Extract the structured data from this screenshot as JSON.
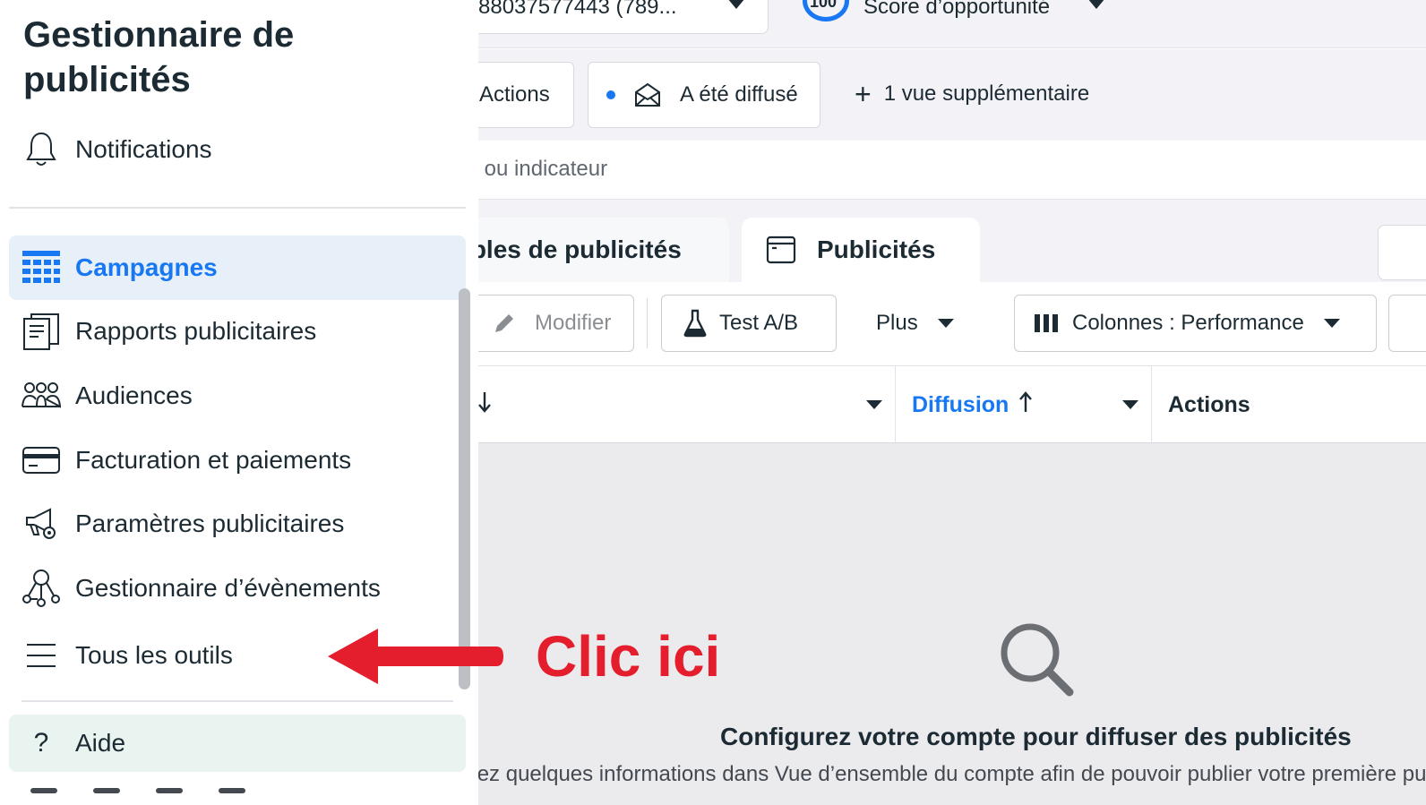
{
  "sidebar": {
    "title": "Gestionnaire de publicités",
    "notifications": "Notifications",
    "items": [
      {
        "label": "Campagnes",
        "icon": "table-grid-icon",
        "active": true
      },
      {
        "label": "Rapports publicitaires",
        "icon": "report-icon"
      },
      {
        "label": "Audiences",
        "icon": "audience-icon"
      },
      {
        "label": "Facturation et paiements",
        "icon": "credit-card-icon"
      },
      {
        "label": "Paramètres publicitaires",
        "icon": "megaphone-gear-icon"
      },
      {
        "label": "Gestionnaire d’évènements",
        "icon": "events-network-icon"
      },
      {
        "label": "Tous les outils",
        "icon": "menu-icon"
      }
    ],
    "help": "Aide"
  },
  "topbar": {
    "account": "88037577443 (789...",
    "score_value": "100",
    "score_label": "Score d’opportunité"
  },
  "views": {
    "actions": "Actions",
    "diffuse": "A été diffusé",
    "more": "1 vue supplémentaire"
  },
  "search": {
    "placeholder": "ID ou indicateur"
  },
  "tabs": {
    "adsets": "Ensembles de publicités",
    "ads": "Publicités"
  },
  "toolbar": {
    "modify": "Modifier",
    "ab_test": "Test A/B",
    "more": "Plus",
    "columns": "Colonnes : Performance"
  },
  "table_header": {
    "diffusion": "Diffusion",
    "actions": "Actions"
  },
  "empty_state": {
    "title": "Configurez votre compte pour diffuser des publicités",
    "subtitle": "Ajoutez quelques informations dans Vue d’ensemble du compte afin de pouvoir publier votre première publicité."
  },
  "annotation": {
    "text": "Clic ici",
    "color": "#e41e2c"
  },
  "colors": {
    "accent": "#1877f2",
    "active_bg": "#e7f0f9"
  }
}
